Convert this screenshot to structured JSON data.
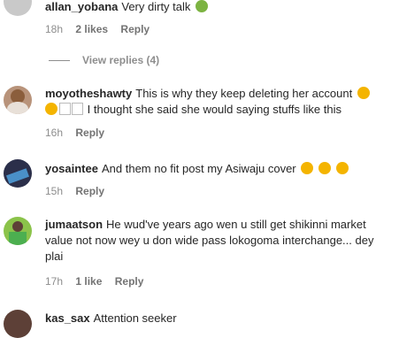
{
  "comments": [
    {
      "username": "allan_yobana",
      "text": "Very dirty talk",
      "emoji": "nauseated-face",
      "time": "18h",
      "likes": "2 likes",
      "reply": "Reply",
      "view_replies": "View replies (4)"
    },
    {
      "username": "moyotheshawty",
      "text_line1": "This is why they keep deleting her account",
      "text_line2": "I thought she said she would saying stuffs like this",
      "emoji": "loudly-crying-face",
      "time": "16h",
      "reply": "Reply"
    },
    {
      "username": "yosaintee",
      "text": "And them no fit post my Asiwaju cover",
      "emoji": "disappointed-face",
      "time": "15h",
      "reply": "Reply"
    },
    {
      "username": "jumaatson",
      "text": "He wud've years ago wen u still get shikinni market value not now wey u don wide pass lokogoma interchange... dey plai",
      "time": "17h",
      "likes": "1 like",
      "reply": "Reply"
    },
    {
      "username": "kas_sax",
      "text": "Attention seeker"
    }
  ],
  "colors": {
    "username": "#262626",
    "meta": "#8e8e8e",
    "emoji_green": "#7cb342",
    "emoji_yellow": "#f4b400"
  }
}
